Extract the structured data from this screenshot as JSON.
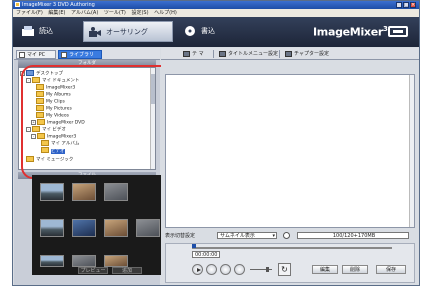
{
  "window": {
    "title": "ImageMixer 3 DVD Authoring"
  },
  "menubar": [
    "ファイル(F)",
    "編集(E)",
    "アルバム(A)",
    "ツール(T)",
    "設定(S)",
    "ヘルプ(H)"
  ],
  "modes": [
    {
      "label": "読込",
      "icon": "import-icon",
      "active": false
    },
    {
      "label": "オーサリング",
      "icon": "authoring-icon",
      "active": true
    },
    {
      "label": "書込",
      "icon": "write-icon",
      "active": false
    }
  ],
  "brand": {
    "name": "ImageMixer",
    "version": "3"
  },
  "source_tabs": {
    "mycomputer": "マイ PC",
    "library": "ライブラリ"
  },
  "folder_panel": {
    "header": "フォルダ",
    "tree": [
      {
        "label": "デスクトップ",
        "level": 0,
        "expander": "-"
      },
      {
        "label": "マイ ドキュメント",
        "level": 1,
        "expander": "-"
      },
      {
        "label": "ImageMixer3",
        "level": 2,
        "expander": ""
      },
      {
        "label": "My Albums",
        "level": 2,
        "expander": ""
      },
      {
        "label": "My Clips",
        "level": 2,
        "expander": ""
      },
      {
        "label": "My Pictures",
        "level": 2,
        "expander": ""
      },
      {
        "label": "My Videos",
        "level": 2,
        "expander": ""
      },
      {
        "label": "ImageMixer DVD",
        "level": 2,
        "expander": "+"
      },
      {
        "label": "マイ ビデオ",
        "level": 1,
        "expander": "-"
      },
      {
        "label": "ImageMixer3",
        "level": 2,
        "expander": "-"
      },
      {
        "label": "マイ アルバム",
        "level": 3,
        "expander": ""
      },
      {
        "label": "ビデオ",
        "level": 3,
        "expander": "",
        "selected": true
      },
      {
        "label": "マイ ミュージック",
        "level": 1,
        "expander": ""
      }
    ]
  },
  "clip_panel": {
    "header": "ファイル",
    "buttons": [
      "プレビュー",
      "追加"
    ]
  },
  "right_toolbar": {
    "items": [
      {
        "label": "テ マ",
        "icon": "theme-icon"
      },
      {
        "label": "タイトルメニュー設定",
        "icon": "title-menu-icon"
      },
      {
        "label": "チャプター設定",
        "icon": "chapter-icon"
      }
    ]
  },
  "status": {
    "label": "表示切替設定",
    "select_value": "サムネイル表示",
    "total": "100/120+170MB"
  },
  "player": {
    "timecode": "00:00:00",
    "buttons": [
      "編集",
      "削除",
      "保存"
    ]
  }
}
